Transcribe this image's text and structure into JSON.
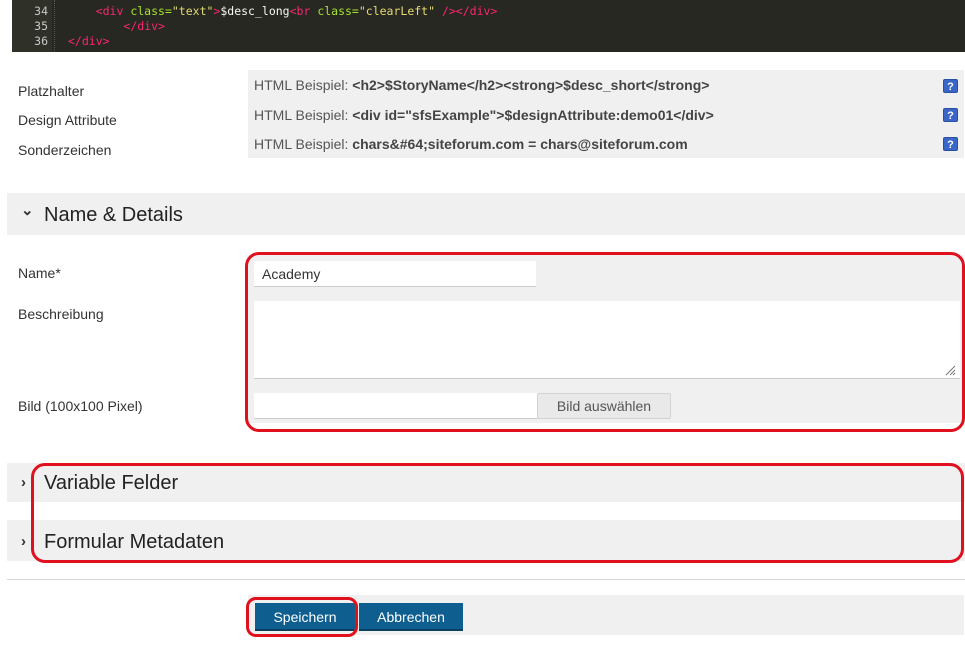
{
  "code_editor": {
    "lines": [
      {
        "num": "34",
        "indent": "    ",
        "parts": [
          {
            "t": "tag",
            "v": "<div "
          },
          {
            "t": "attr",
            "v": "class="
          },
          {
            "t": "str",
            "v": "\"text\""
          },
          {
            "t": "tag",
            "v": ">"
          },
          {
            "t": "txt",
            "v": "$desc_long"
          },
          {
            "t": "tag",
            "v": "<br "
          },
          {
            "t": "attr",
            "v": "class="
          },
          {
            "t": "str",
            "v": "\"clearLeft\""
          },
          {
            "t": "tag",
            "v": " /></div>"
          }
        ]
      },
      {
        "num": "35",
        "indent": "        ",
        "parts": [
          {
            "t": "tag",
            "v": "</div>"
          }
        ]
      },
      {
        "num": "36",
        "indent": "",
        "parts": [
          {
            "t": "tag",
            "v": "</div>"
          }
        ]
      }
    ]
  },
  "hints": {
    "labels": [
      "Platzhalter",
      "Design Attribute",
      "Sonderzeichen"
    ],
    "rows": [
      {
        "prefix": "HTML Beispiel: ",
        "example": "<h2>$StoryName</h2><strong>$desc_short</strong>"
      },
      {
        "prefix": "HTML Beispiel: ",
        "example": "<div id=\"sfsExample\">$designAttribute:demo01</div>"
      },
      {
        "prefix": "HTML Beispiel: ",
        "example": "chars&#64;siteforum.com = chars@siteforum.com"
      }
    ],
    "help_icon": "?"
  },
  "sections": {
    "name_details": {
      "title": "Name & Details",
      "chevron": "⌄"
    },
    "variable_felder": {
      "title": "Variable Felder",
      "chevron": "›"
    },
    "formular_metadaten": {
      "title": "Formular Metadaten",
      "chevron": "›"
    }
  },
  "form": {
    "name_label": "Name*",
    "name_value": "Academy",
    "description_label": "Beschreibung",
    "description_value": "",
    "image_label": "Bild (100x100 Pixel)",
    "image_value": "",
    "image_button": "Bild auswählen"
  },
  "actions": {
    "save": "Speichern",
    "cancel": "Abbrechen"
  },
  "colors": {
    "annotation_red": "#e0101e",
    "button_blue": "#0e5f8f",
    "help_icon_blue": "#3a66c8"
  }
}
